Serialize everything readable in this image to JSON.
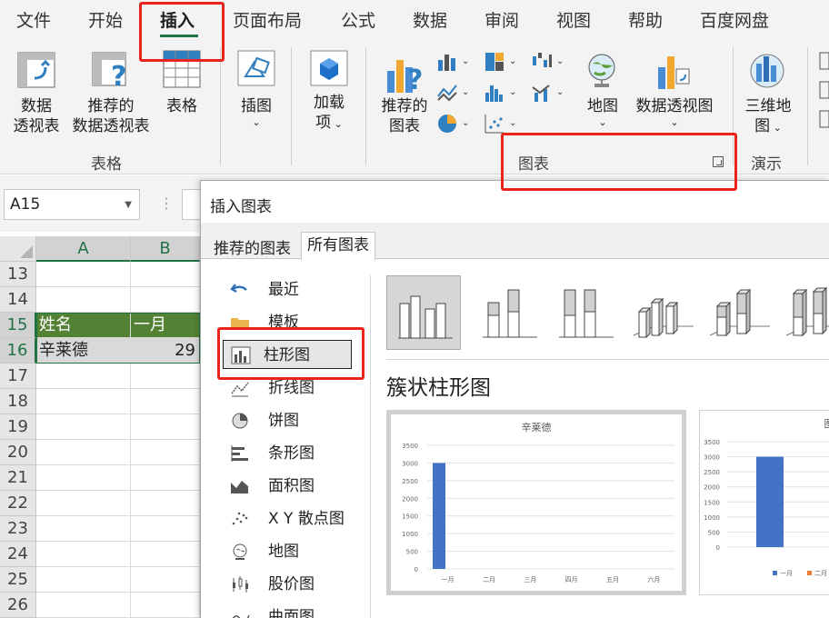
{
  "tabs": [
    "文件",
    "开始",
    "插入",
    "页面布局",
    "公式",
    "数据",
    "审阅",
    "视图",
    "帮助",
    "百度网盘"
  ],
  "ribbon": {
    "pivot_table": "数据\n透视表",
    "pivot_table_l1": "数据",
    "pivot_table_l2": "透视表",
    "rec_pivot_l1": "推荐的",
    "rec_pivot_l2": "数据透视表",
    "table": "表格",
    "illustrations": "插图",
    "addins_l1": "加载",
    "addins_l2": "项",
    "rec_chart_l1": "推荐的",
    "rec_chart_l2": "图表",
    "map": "地图",
    "pivot_chart": "数据透视图",
    "map3d_l1": "三维地",
    "map3d_l2": "图",
    "group_tables": "表格",
    "group_charts": "图表",
    "group_tours": "演示"
  },
  "namebox": "A15",
  "sheet": {
    "columns": [
      "A",
      "B"
    ],
    "rows": [
      "13",
      "14",
      "15",
      "16",
      "17",
      "18",
      "19",
      "20",
      "21",
      "22",
      "23",
      "24",
      "25",
      "26"
    ],
    "cells": {
      "A15": "姓名",
      "B15": "一月",
      "A16": "辛莱德",
      "B16": "29"
    }
  },
  "dialog": {
    "title": "插入图表",
    "tab_recommended": "推荐的图表",
    "tab_all": "所有图表",
    "nav": [
      {
        "label": "最近",
        "icon": "undo-icon"
      },
      {
        "label": "模板",
        "icon": "folder-icon"
      },
      {
        "label": "柱形图",
        "icon": "column-chart-icon"
      },
      {
        "label": "折线图",
        "icon": "line-chart-icon"
      },
      {
        "label": "饼图",
        "icon": "pie-chart-icon"
      },
      {
        "label": "条形图",
        "icon": "bar-chart-icon"
      },
      {
        "label": "面积图",
        "icon": "area-chart-icon"
      },
      {
        "label": "X Y 散点图",
        "icon": "scatter-chart-icon"
      },
      {
        "label": "地图",
        "icon": "map-chart-icon"
      },
      {
        "label": "股价图",
        "icon": "stock-chart-icon"
      },
      {
        "label": "曲面图",
        "icon": "surface-chart-icon"
      }
    ],
    "subtype_title": "簇状柱形图",
    "preview1": {
      "title": "辛莱德",
      "yticks": [
        "3500",
        "3000",
        "2500",
        "2000",
        "1500",
        "1000",
        "500",
        "0"
      ],
      "xticks": [
        "一月",
        "二月",
        "三月",
        "四月",
        "五月",
        "六月"
      ],
      "values": [
        3000,
        0,
        0,
        0,
        0,
        0
      ],
      "ymax": 3500
    },
    "preview2": {
      "title": "图",
      "yticks": [
        "3500",
        "3000",
        "2500",
        "2000",
        "1500",
        "1000",
        "500",
        "0"
      ],
      "values": [
        3000
      ],
      "ymax": 3500,
      "legend": [
        "一月",
        "二月"
      ]
    }
  },
  "colors": {
    "accent": "#217346",
    "header_fill": "#548235",
    "highlight": "#e8241c",
    "bar": "#4472c4"
  }
}
